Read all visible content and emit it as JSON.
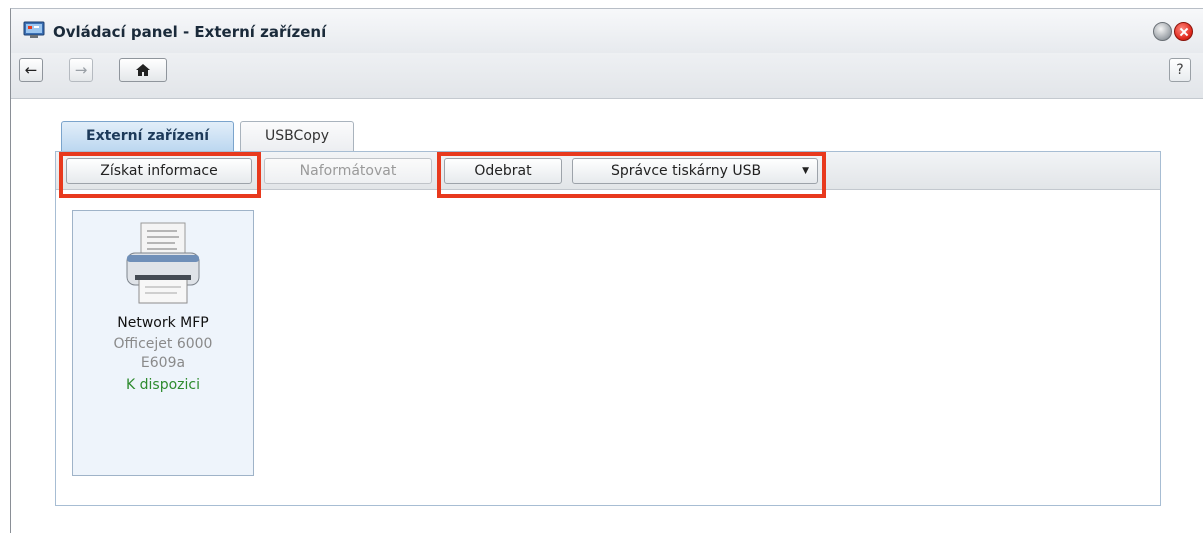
{
  "window": {
    "title": "Ovládací panel - Externí zařízení"
  },
  "toolbar": {
    "back_icon": "arrow-left-icon",
    "forward_icon": "arrow-right-icon",
    "home_icon": "home-icon",
    "help_label": "?"
  },
  "tabs": [
    {
      "label": "Externí zařízení",
      "active": true
    },
    {
      "label": "USBCopy",
      "active": false
    }
  ],
  "actions": {
    "get_info": "Získat informace",
    "format": "Naformátovat",
    "remove": "Odebrat",
    "printer_manager": "Správce tiskárny USB"
  },
  "device": {
    "name": "Network MFP",
    "model": "Officejet 6000 E609a",
    "status": "K dispozici",
    "icon": "printer-icon"
  },
  "colors": {
    "highlight": "#e8391d",
    "status_ok": "#2e8b2e",
    "active_tab": "#bcd7f0"
  }
}
